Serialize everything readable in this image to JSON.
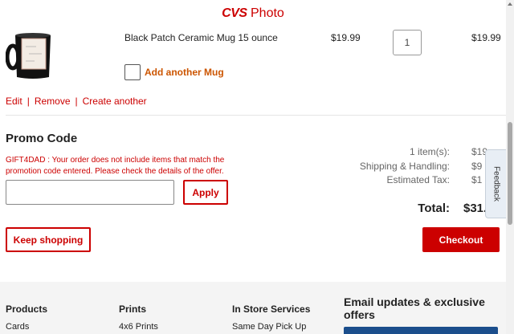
{
  "header": {
    "logo_cvs": "CVS",
    "logo_photo": " Photo"
  },
  "cart_item": {
    "name": "Black Patch Ceramic Mug 15 ounce",
    "price": "$19.99",
    "quantity": "1",
    "line_total": "$19.99",
    "add_another_label": "Add another Mug",
    "links": {
      "edit": "Edit",
      "remove": "Remove",
      "create_another": "Create another",
      "separator": "|"
    }
  },
  "promo": {
    "title": "Promo Code",
    "error": "GIFT4DAD : Your order does not include items that match the promotion code entered. Please check the details of the offer.",
    "input_value": "",
    "apply_label": "Apply"
  },
  "summary": {
    "items_label": "1 item(s):",
    "items_value": "$19",
    "shipping_label": "Shipping & Handling:",
    "shipping_value": "$9",
    "tax_label": "Estimated Tax:",
    "tax_value": "$1",
    "total_label": "Total:",
    "total_value": "$31."
  },
  "actions": {
    "keep_shopping": "Keep shopping",
    "checkout": "Checkout"
  },
  "feedback_tab": "Feedback",
  "footer": {
    "columns": [
      {
        "heading": "Products",
        "link": "Cards"
      },
      {
        "heading": "Prints",
        "link": "4x6 Prints"
      },
      {
        "heading": "In Store Services",
        "link": "Same Day Pick Up"
      }
    ],
    "email_heading": "Email updates & exclusive offers"
  },
  "colors": {
    "brand_red": "#cc0000",
    "add_orange": "#cc5500",
    "footer_bg": "#f4f4f4",
    "signup_blue": "#1b4e8c"
  }
}
